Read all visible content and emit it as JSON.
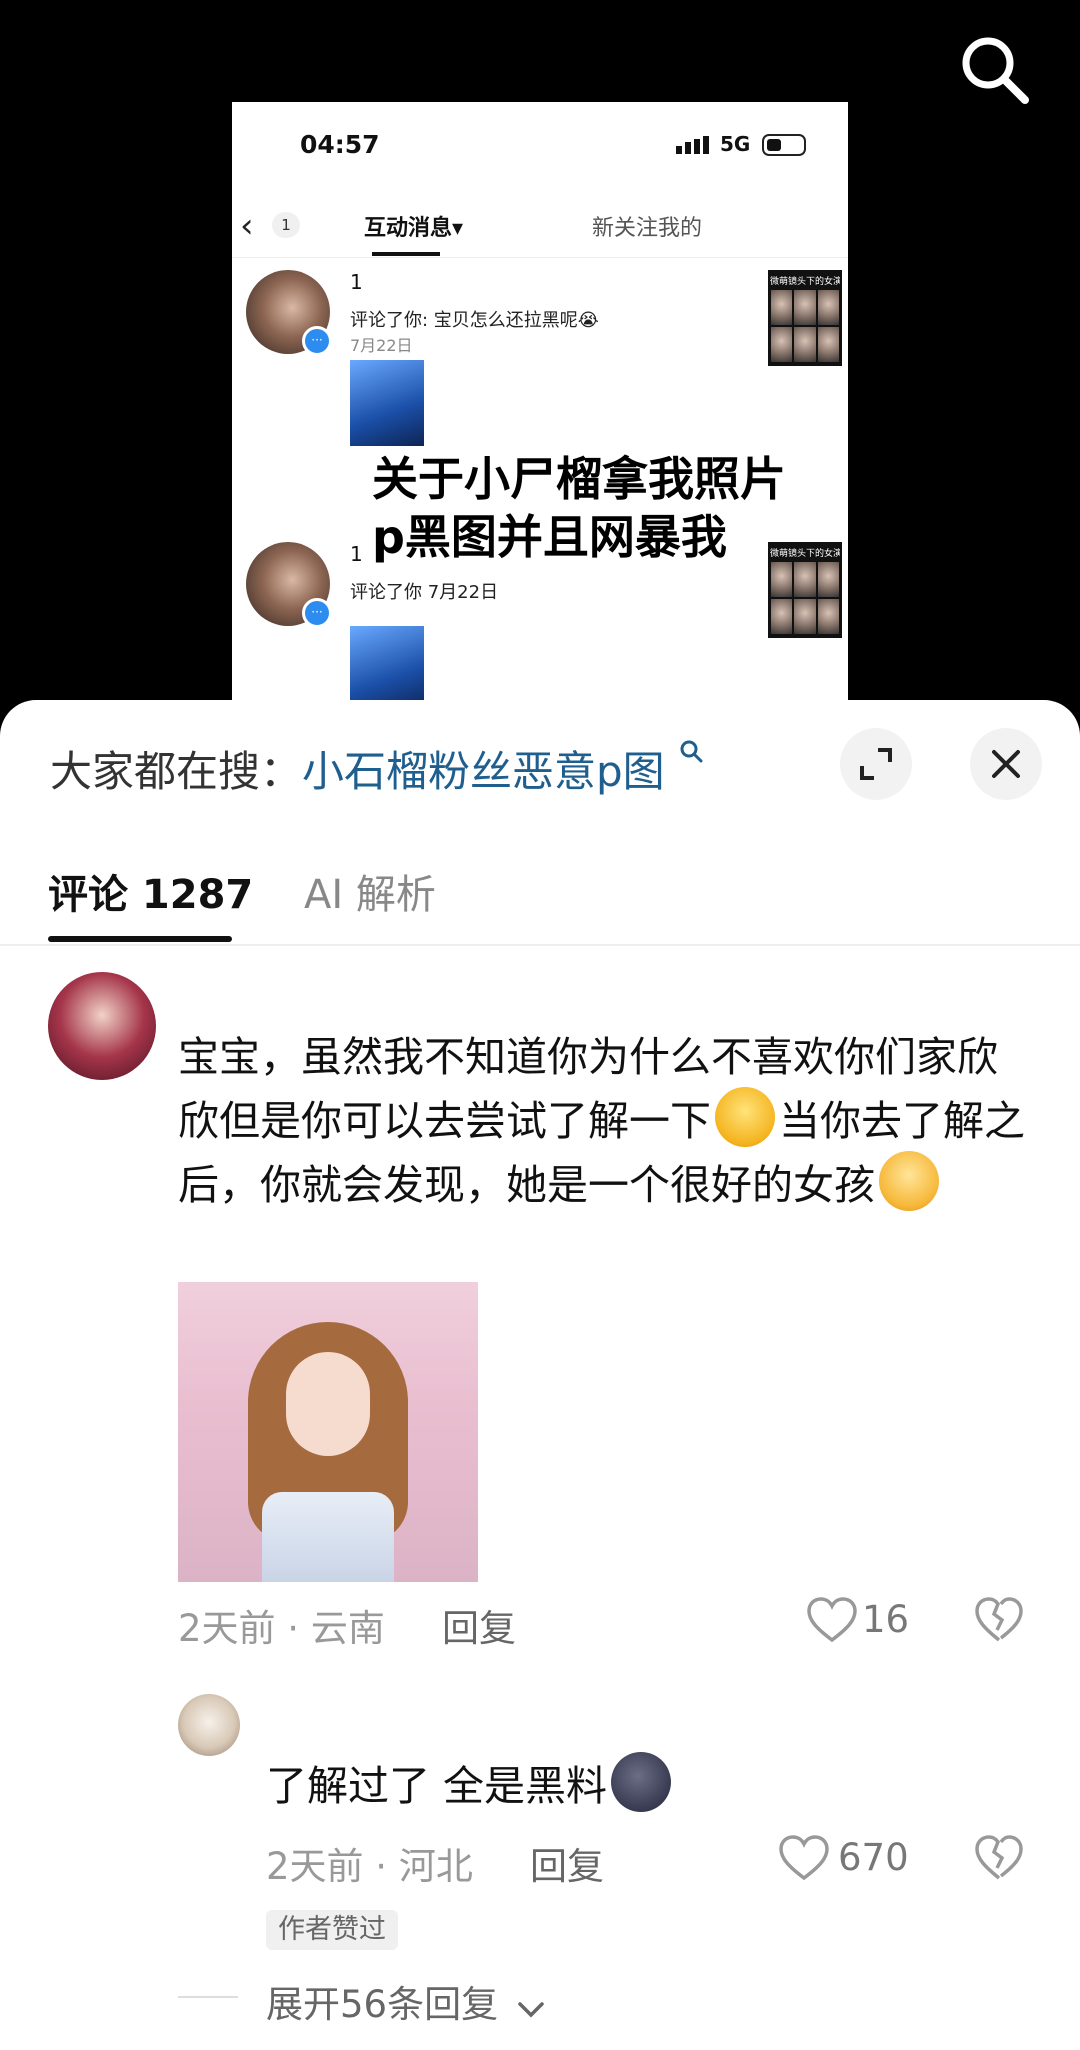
{
  "video": {
    "phone": {
      "time": "04:57",
      "network": "5G",
      "back_badge": "1",
      "tab_active": "互动消息▾",
      "tab_other": "新关注我的",
      "messages": [
        {
          "name": "1",
          "text": "评论了你: 宝贝怎么还拉黑呢😭",
          "date": "7月22日",
          "thumb_label": "微萌镜头下的女演"
        },
        {
          "name": "1",
          "text": "评论了你  7月22日",
          "date": "",
          "thumb_label": "微萌镜头下的女演"
        }
      ]
    },
    "overlay_line1": "关于小尸榴拿我照片",
    "overlay_line2": "p黑图并且网暴我"
  },
  "sheet": {
    "hot_search_prefix": "大家都在搜：",
    "hot_search_term": "小石榴粉丝恶意p图",
    "tab_comments": "评论 1287",
    "tab_ai": "AI 解析"
  },
  "comment": {
    "text_part1": "宝宝，虽然我不知道你为什么不喜欢你们家欣欣但是你可以去尝试了解一下",
    "text_part2": "当你去了解之后，你就会发现，她是一个很好的女孩",
    "meta": "2天前 · 云南",
    "reply_label": "回复",
    "likes": "16"
  },
  "reply": {
    "text": "了解过了 全是黑料",
    "meta": "2天前 · 河北",
    "reply_label": "回复",
    "likes": "670",
    "author_badge": "作者赞过",
    "expand_label": "展开56条回复"
  },
  "colors": {
    "hot_term": "#1f5f8f",
    "meta_gray": "#999999",
    "text_dark": "#111111"
  },
  "icons": [
    "search-icon",
    "signal-icon",
    "battery-icon",
    "back-chevron-icon",
    "expand-icon",
    "close-icon",
    "heart-icon",
    "broken-heart-icon",
    "chevron-down-icon",
    "magnifier-small-icon"
  ]
}
